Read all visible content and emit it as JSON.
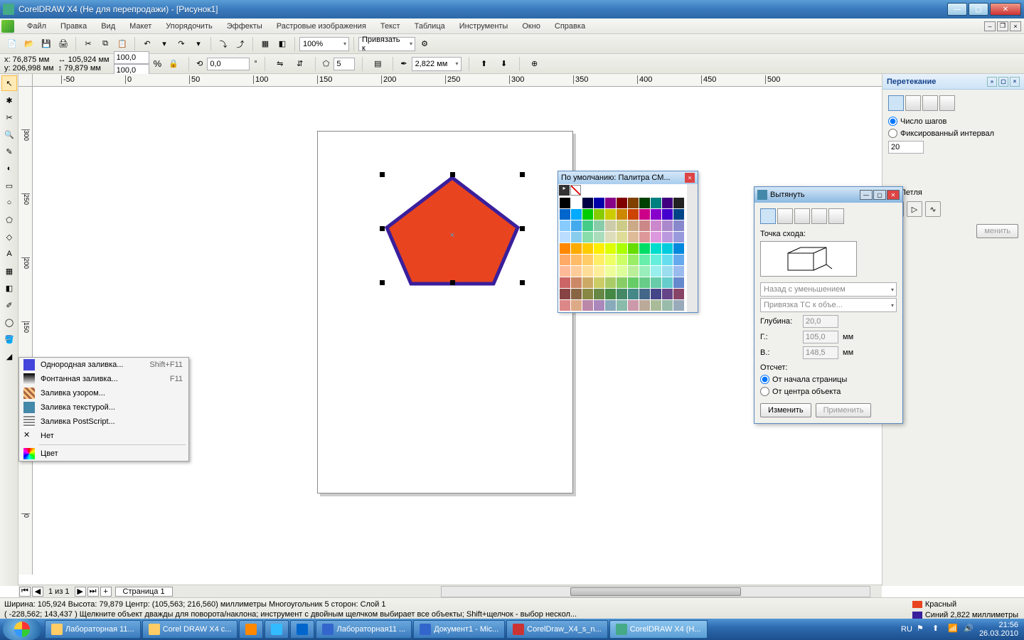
{
  "title": "CorelDRAW X4 (Не для перепродажи) - [Рисунок1]",
  "menu": [
    "Файл",
    "Правка",
    "Вид",
    "Макет",
    "Упорядочить",
    "Эффекты",
    "Растровые изображения",
    "Текст",
    "Таблица",
    "Инструменты",
    "Окно",
    "Справка"
  ],
  "toolbar": {
    "zoom": "100%",
    "snap_label": "Привязать к"
  },
  "prop": {
    "x": "76,875 мм",
    "y": "206,998 мм",
    "w": "105,924 мм",
    "h": "79,879 мм",
    "sx": "100,0",
    "sy": "100,0",
    "angle": "0,0",
    "sides": "5",
    "outline": "2,822 мм"
  },
  "ruler_unit": "миллиметры",
  "context": {
    "items": [
      {
        "label": "Однородная заливка...",
        "sc": "Shift+F11"
      },
      {
        "label": "Фонтанная заливка...",
        "sc": "F11"
      },
      {
        "label": "Заливка узором..."
      },
      {
        "label": "Заливка текстурой..."
      },
      {
        "label": "Заливка PostScript..."
      },
      {
        "label": "Нет"
      }
    ],
    "color": "Цвет"
  },
  "palette": {
    "title": "По умолчанию: Палитра СМ..."
  },
  "palette_colors": [
    "#000",
    "#fff",
    "#004",
    "#00a",
    "#808",
    "#800000",
    "#804000",
    "#004000",
    "#008080",
    "#400080",
    "#222",
    "#06c",
    "#0af",
    "#0c0",
    "#8c0",
    "#cc0",
    "#c80",
    "#c40",
    "#c08",
    "#80c",
    "#40c",
    "#048",
    "#8cf",
    "#4ae",
    "#4c8",
    "#8ca",
    "#cca",
    "#cc8",
    "#ca8",
    "#c88",
    "#c8c",
    "#a8c",
    "#88c",
    "#bdf",
    "#8ce",
    "#8da",
    "#adb",
    "#ddb",
    "#dd9",
    "#db9",
    "#d99",
    "#d9d",
    "#b9d",
    "#99d",
    "#f80",
    "#fa0",
    "#fc0",
    "#fe0",
    "#df0",
    "#af0",
    "#6d0",
    "#0d6",
    "#0dc",
    "#0cd",
    "#08d",
    "#fa6",
    "#fb6",
    "#fc6",
    "#fe6",
    "#ef6",
    "#cf6",
    "#9e6",
    "#6ea",
    "#6ed",
    "#6de",
    "#6ae",
    "#fb9",
    "#fc9",
    "#fd9",
    "#fe9",
    "#ef9",
    "#df9",
    "#be9",
    "#9eb",
    "#9ee",
    "#9de",
    "#9be",
    "#c66",
    "#c86",
    "#ca6",
    "#cc6",
    "#ac6",
    "#8c6",
    "#6c6",
    "#6c8",
    "#6ca",
    "#6cc",
    "#68c",
    "#844",
    "#864",
    "#884",
    "#684",
    "#484",
    "#486",
    "#488",
    "#468",
    "#448",
    "#648",
    "#846",
    "#d88",
    "#da8",
    "#b8a",
    "#a8b",
    "#8ab",
    "#8ba",
    "#c9a",
    "#ba9",
    "#ab9",
    "#9ba",
    "#9ab"
  ],
  "blend_docker": {
    "title": "Перетекание",
    "steps_label": "Число шагов",
    "fixed_label": "Фиксированный интервал",
    "steps": "20",
    "loop": "Петля",
    "apply": "менить"
  },
  "extrude": {
    "title": "Вытянуть",
    "vanish": "Точка схода:",
    "preset": "Назад с уменьшением",
    "snap": "Привязка ТС к объе...",
    "depth_l": "Глубина:",
    "depth": "20,0",
    "h_l": "Г.:",
    "h": "105,0",
    "v_l": "В.:",
    "v": "148,5",
    "unit": "мм",
    "from": "Отсчет:",
    "opt1": "От начала страницы",
    "opt2": "От центра объекта",
    "edit": "Изменить",
    "apply": "Применить"
  },
  "pagenav": {
    "pages": "1 из 1",
    "tab": "Страница 1"
  },
  "status": {
    "line1": "Ширина: 105,924  Высота: 79,879  Центр: (105,563; 216,560)  миллиметры       Многоугольник  5 сторон:  Слой 1",
    "line2": "( -228,562; 143,437 )     Щелкните объект дважды для поворота/наклона; инструмент с двойным щелчком выбирает все объекты; Shift+щелчок - выбор нескол...",
    "fill": "Красный",
    "stroke": "Синий  2,822 миллиметры"
  },
  "tasks": [
    "Лабораторная 11...",
    "Corel DRAW X4 с...",
    "",
    "",
    "",
    "Лабораторная11 ...",
    "Документ1 - Mic...",
    "CorelDraw_X4_s_n...",
    "CorelDRAW X4 (Н..."
  ],
  "tray": {
    "lang": "RU",
    "time": "21:56",
    "date": "26.03.2010"
  }
}
